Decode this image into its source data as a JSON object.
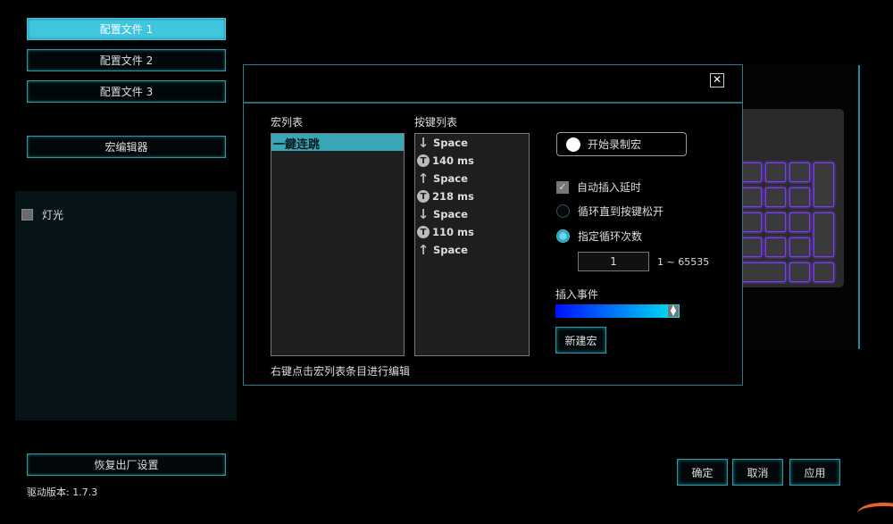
{
  "sidebar": {
    "profiles": [
      "配置文件 1",
      "配置文件 2",
      "配置文件 3"
    ],
    "macro_editor": "宏编辑器",
    "lighting": "灯光",
    "reset": "恢复出厂设置",
    "version": "驱动版本: 1.7.3"
  },
  "dialog": {
    "close": "✕",
    "macro_list_label": "宏列表",
    "macros": [
      "一鍵连跳"
    ],
    "key_list_label": "按键列表",
    "keys": [
      {
        "type": "down",
        "text": "Space"
      },
      {
        "type": "delay",
        "text": "140 ms"
      },
      {
        "type": "up",
        "text": "Space"
      },
      {
        "type": "delay",
        "text": "218 ms"
      },
      {
        "type": "down",
        "text": "Space"
      },
      {
        "type": "delay",
        "text": "110 ms"
      },
      {
        "type": "up",
        "text": "Space"
      }
    ],
    "record": "开始录制宏",
    "auto_delay": "自动插入延时",
    "loop_until_release": "循环直到按键松开",
    "loop_count": "指定循环次数",
    "loop_value": "1",
    "loop_range": "1 ~ 65535",
    "insert_event": "插入事件",
    "new_macro": "新建宏",
    "hint": "右键点击宏列表条目进行编辑"
  },
  "footer": {
    "ok": "确定",
    "cancel": "取消",
    "apply": "应用"
  }
}
